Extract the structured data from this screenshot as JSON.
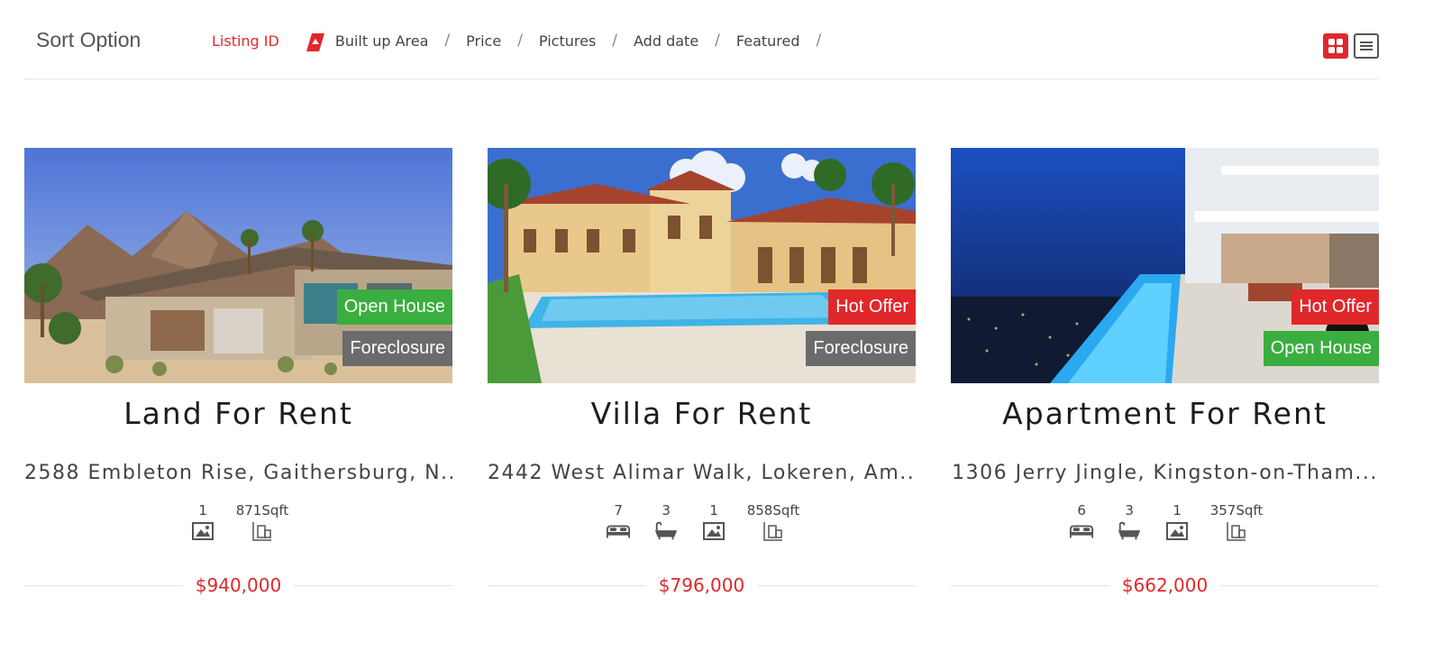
{
  "sort": {
    "title": "Sort Option",
    "options": [
      {
        "label": "Listing ID",
        "active": true
      },
      {
        "label": "Built up Area",
        "active": false
      },
      {
        "label": "Price",
        "active": false
      },
      {
        "label": "Pictures",
        "active": false
      },
      {
        "label": "Add date",
        "active": false
      },
      {
        "label": "Featured",
        "active": false
      }
    ],
    "separator": "/",
    "sort_icon": "sort-direction-icon",
    "view_grid_icon": "grid-view-icon",
    "view_list_icon": "list-view-icon"
  },
  "colors": {
    "accent": "#e0282b",
    "badge_green": "#3aae3e",
    "badge_gray": "#6b6b6b",
    "badge_red": "#e0282b"
  },
  "listings": [
    {
      "title": "Land For Rent",
      "address": "2588 Embleton Rise, Gaithersburg, N...",
      "badges": [
        {
          "label": "Open House",
          "color": "#3aae3e"
        },
        {
          "label": "Foreclosure",
          "color": "#6b6b6b"
        }
      ],
      "features": [
        {
          "value": "1",
          "icon": "pictures-icon"
        },
        {
          "value": "871Sqft",
          "icon": "area-icon"
        }
      ],
      "price": "$940,000"
    },
    {
      "title": "Villa For Rent",
      "address": "2442 West Alimar Walk, Lokeren, Am...",
      "badges": [
        {
          "label": "Hot Offer",
          "color": "#e0282b"
        },
        {
          "label": "Foreclosure",
          "color": "#6b6b6b"
        }
      ],
      "features": [
        {
          "value": "7",
          "icon": "bed-icon"
        },
        {
          "value": "3",
          "icon": "bath-icon"
        },
        {
          "value": "1",
          "icon": "pictures-icon"
        },
        {
          "value": "858Sqft",
          "icon": "area-icon"
        }
      ],
      "price": "$796,000"
    },
    {
      "title": "Apartment For Rent",
      "address": "1306 Jerry Jingle, Kingston-on-Tham...",
      "badges": [
        {
          "label": "Hot Offer",
          "color": "#e0282b"
        },
        {
          "label": "Open House",
          "color": "#3aae3e"
        }
      ],
      "features": [
        {
          "value": "6",
          "icon": "bed-icon"
        },
        {
          "value": "3",
          "icon": "bath-icon"
        },
        {
          "value": "1",
          "icon": "pictures-icon"
        },
        {
          "value": "357Sqft",
          "icon": "area-icon"
        }
      ],
      "price": "$662,000"
    }
  ]
}
